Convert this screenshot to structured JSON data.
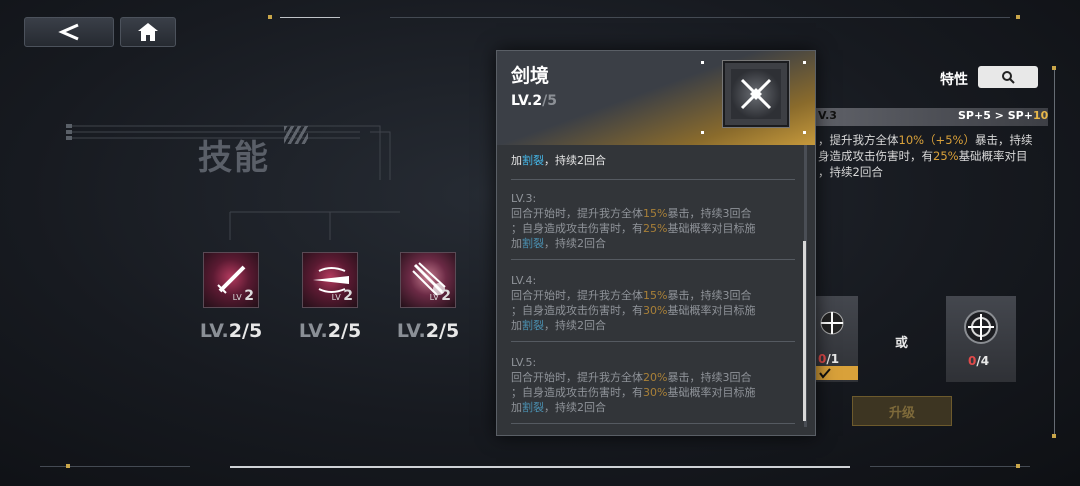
{
  "nav": {
    "back_label": "<",
    "home_icon": "home-icon"
  },
  "skills": {
    "title": "技能",
    "slots": [
      {
        "icon": "sword-icon",
        "small_level": "2",
        "level": "LV.",
        "level_num": "2/5"
      },
      {
        "icon": "blades-icon",
        "small_level": "2",
        "level": "LV.",
        "level_num": "2/5"
      },
      {
        "icon": "burst-icon",
        "small_level": "2",
        "level": "LV.",
        "level_num": "2/5"
      }
    ]
  },
  "detail": {
    "name": "剑境",
    "level_prefix": "LV.2",
    "level_max": "/5",
    "current": {
      "pre": "加",
      "status": "割裂",
      "post": "，持续2回合"
    },
    "levels": [
      {
        "title": "LV.3:",
        "l1a": "回合开始时，提升我方全体",
        "l1b": "15%",
        "l1c": "暴击，持续3回合",
        "l2a": "；自身造成攻击伤害时，有",
        "l2b": "25%",
        "l2c": "基础概率对目标施",
        "l3a": "加",
        "l3b": "割裂",
        "l3c": "，持续2回合"
      },
      {
        "title": "LV.4:",
        "l1a": "回合开始时，提升我方全体",
        "l1b": "15%",
        "l1c": "暴击，持续3回合",
        "l2a": "；自身造成攻击伤害时，有",
        "l2b": "30%",
        "l2c": "基础概率对目标施",
        "l3a": "加",
        "l3b": "割裂",
        "l3c": "，持续2回合"
      },
      {
        "title": "LV.5:",
        "l1a": "回合开始时，提升我方全体",
        "l1b": "20%",
        "l1c": "暴击，持续3回合",
        "l2a": "；自身造成攻击伤害时，有",
        "l2b": "30%",
        "l2c": "基础概率对目标施",
        "l3a": "加",
        "l3b": "割裂",
        "l3c": "，持续2回合"
      }
    ]
  },
  "right": {
    "trait_label": "特性",
    "bar_level": "V.3",
    "sp_from": "SP+5 > SP+",
    "sp_to": "10",
    "desc": {
      "l1a": "，提升我方全体",
      "l1b": "10%（+5%）",
      "l1c": "暴击，持续",
      "l2a": "身造成攻击伤害时，有",
      "l2b": "25%",
      "l2c": "基础概率对目",
      "l3": "，持续2回合"
    },
    "mat1_have": "0",
    "mat1_need": "/1",
    "or_label": "或",
    "mat2_have": "0",
    "mat2_need": "/4",
    "upgrade_label": "升级"
  },
  "colors": {
    "accent_gold": "#d9a13a",
    "status_cyan": "#44b6e8",
    "slot_magenta": "#b33a5e"
  }
}
